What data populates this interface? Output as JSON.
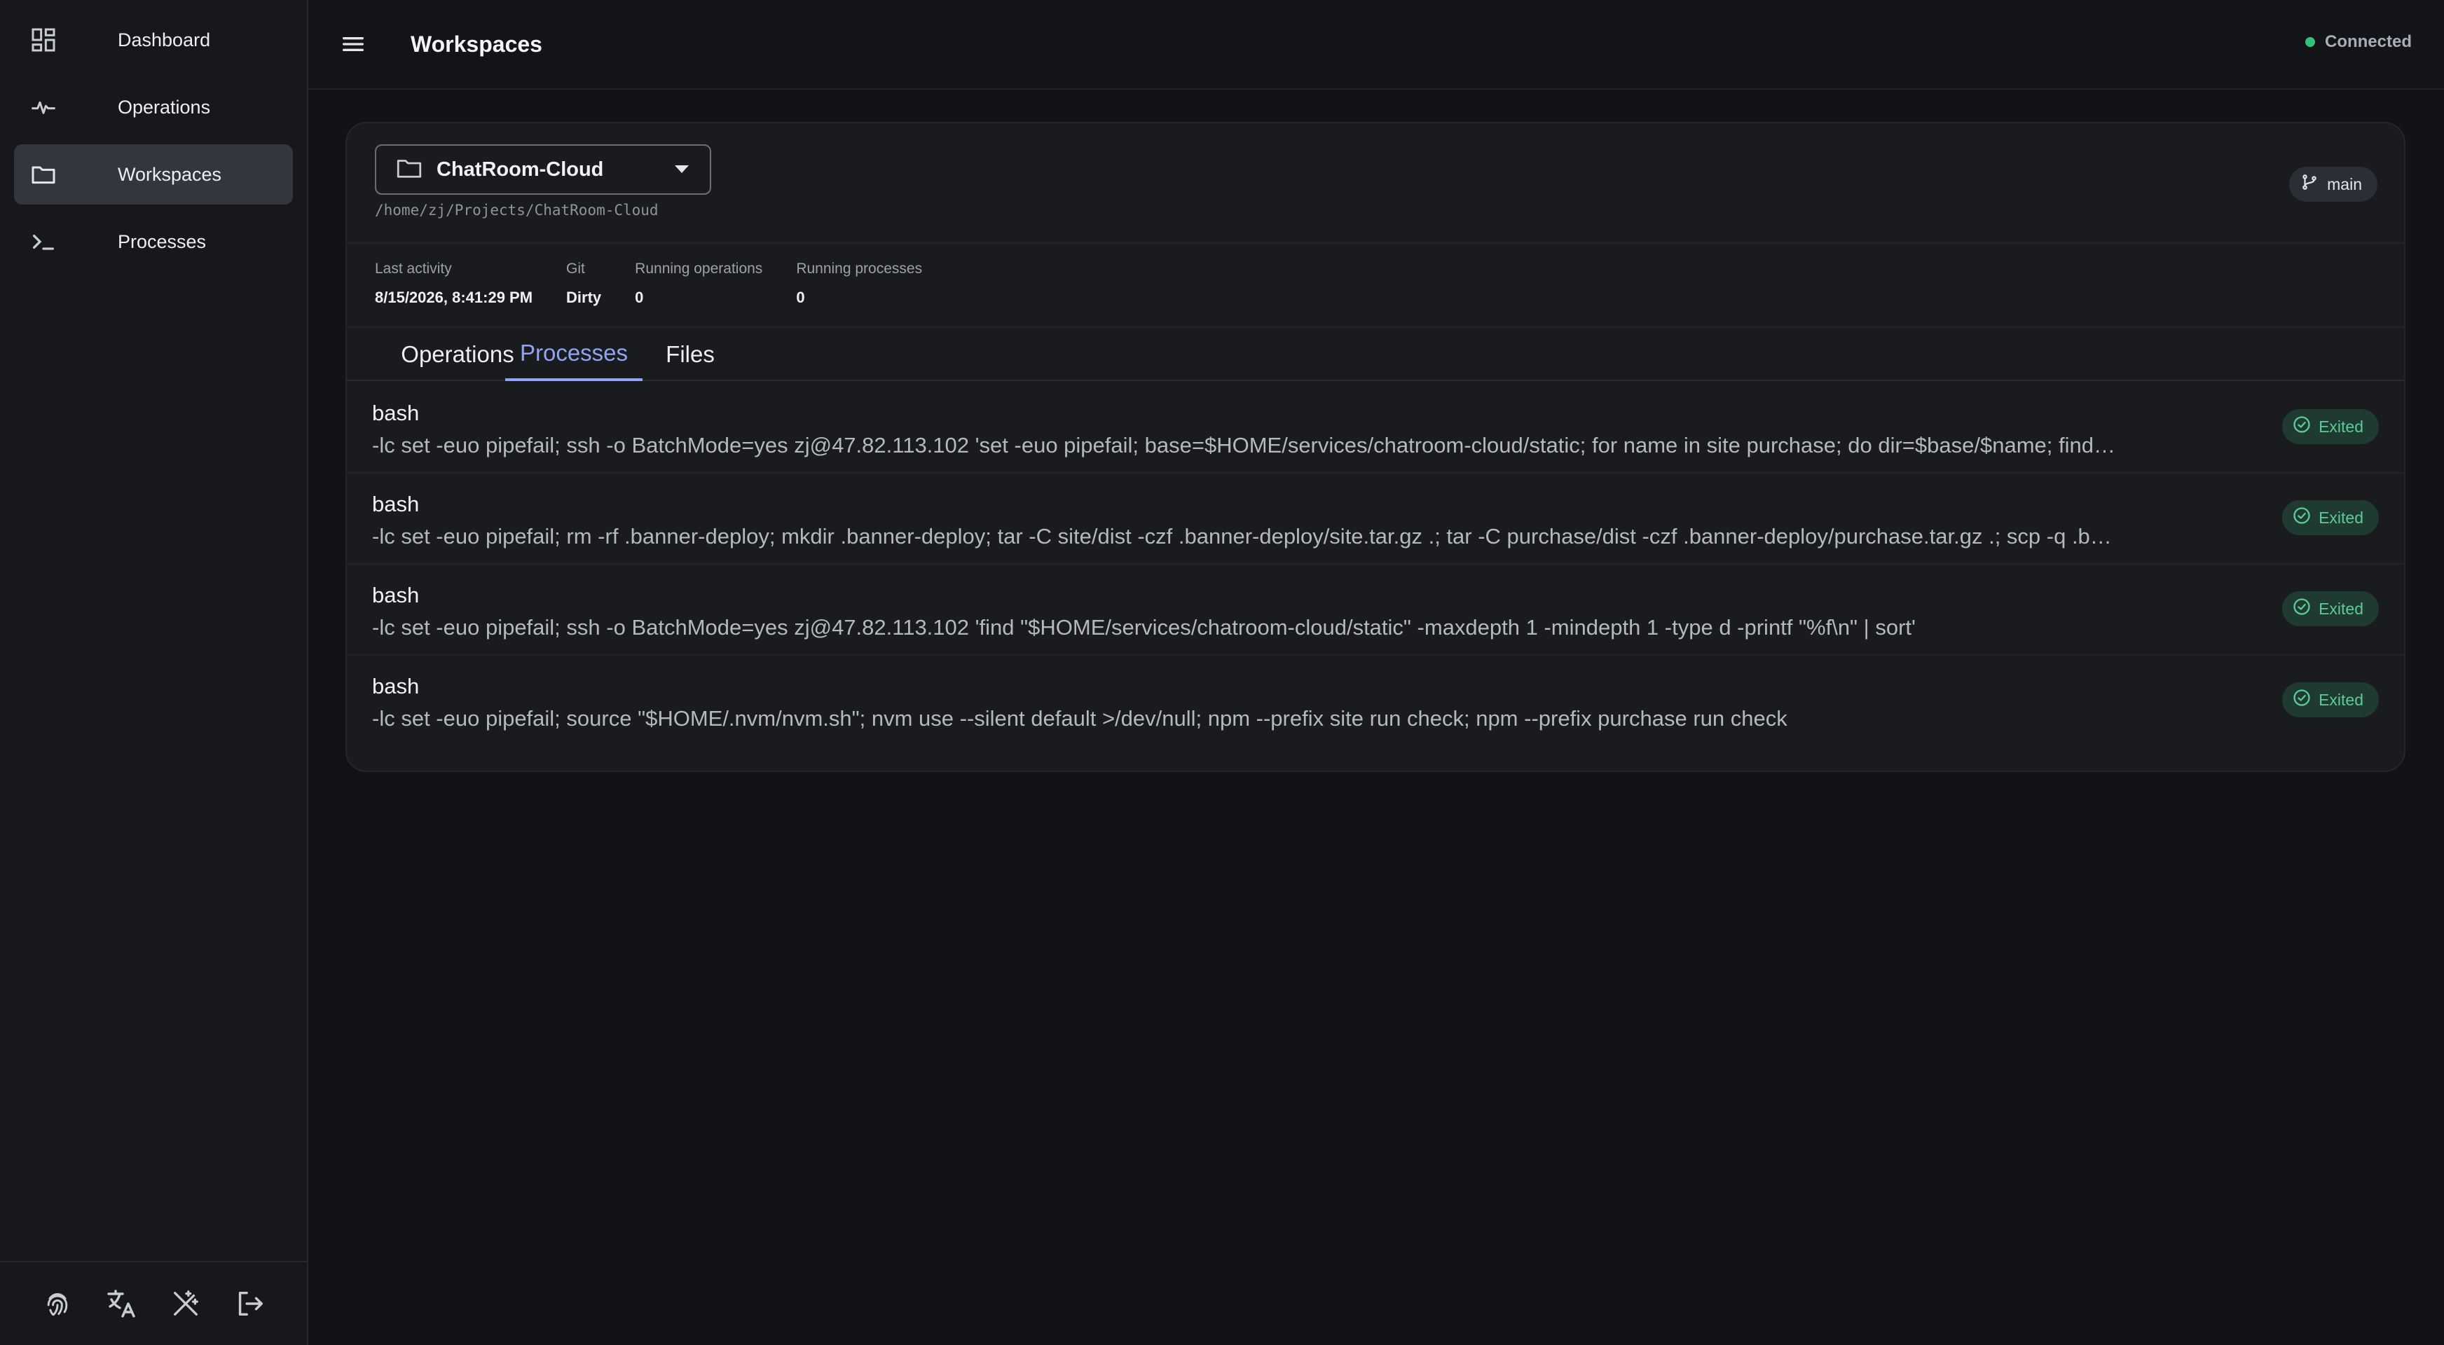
{
  "sidebar": {
    "items": [
      {
        "label": "Dashboard",
        "icon": "dashboard-grid-icon"
      },
      {
        "label": "Operations",
        "icon": "activity-pulse-icon"
      },
      {
        "label": "Workspaces",
        "icon": "folder-icon",
        "active": true
      },
      {
        "label": "Processes",
        "icon": "terminal-prompt-icon"
      }
    ],
    "bottom_icons": [
      "fingerprint-icon",
      "translate-icon",
      "theme-wand-icon",
      "logout-icon"
    ]
  },
  "header": {
    "title": "Workspaces",
    "connection_status": "Connected",
    "connection_color": "#34c27a"
  },
  "workspace": {
    "name": "ChatRoom-Cloud",
    "path": "/home/zj/Projects/ChatRoom-Cloud",
    "branch": "main",
    "stats": [
      {
        "label": "Last activity",
        "value": "8/15/2026, 8:41:29 PM"
      },
      {
        "label": "Git",
        "value": "Dirty"
      },
      {
        "label": "Running operations",
        "value": "0"
      },
      {
        "label": "Running processes",
        "value": "0"
      }
    ],
    "tabs": [
      {
        "label": "Operations"
      },
      {
        "label": "Processes",
        "active": true
      },
      {
        "label": "Files"
      }
    ],
    "accent_color": "#8fa4f2"
  },
  "processes": [
    {
      "name": "bash",
      "command": "-lc set -euo pipefail; ssh -o BatchMode=yes zj@47.82.113.102 'set -euo pipefail; base=$HOME/services/chatroom-cloud/static; for name in site purchase; do dir=$base/$name; find…",
      "status": "Exited"
    },
    {
      "name": "bash",
      "command": "-lc set -euo pipefail; rm -rf .banner-deploy; mkdir .banner-deploy; tar -C site/dist -czf .banner-deploy/site.tar.gz .; tar -C purchase/dist -czf .banner-deploy/purchase.tar.gz .; scp -q .b…",
      "status": "Exited"
    },
    {
      "name": "bash",
      "command": "-lc set -euo pipefail; ssh -o BatchMode=yes zj@47.82.113.102 'find \"$HOME/services/chatroom-cloud/static\" -maxdepth 1 -mindepth 1 -type d -printf \"%f\\n\" | sort'",
      "status": "Exited"
    },
    {
      "name": "bash",
      "command": "-lc set -euo pipefail; source \"$HOME/.nvm/nvm.sh\"; nvm use --silent default >/dev/null; npm --prefix site run check; npm --prefix purchase run check",
      "status": "Exited"
    }
  ]
}
